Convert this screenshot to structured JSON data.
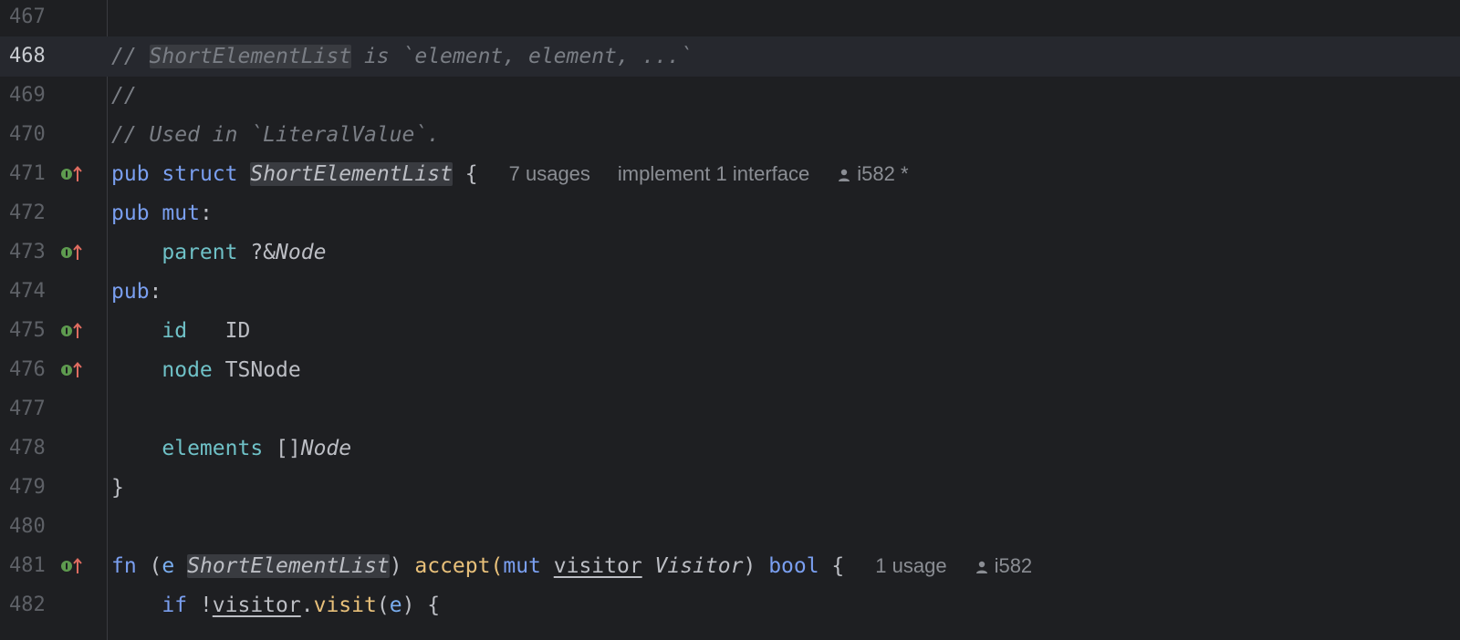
{
  "editor": {
    "colors": {
      "background": "#1e1f22",
      "current_line": "#26282e",
      "keyword": "#7a9ff0",
      "field": "#6fc1c7",
      "function": "#e8c07a",
      "comment": "#7a7e85",
      "gutter_icon_green": "#5e9b4f",
      "gutter_icon_red": "#e06c60"
    },
    "lines": [
      {
        "num": "467"
      },
      {
        "num": "468",
        "t": [
          "// ",
          "ShortElementList",
          " is `element, element, ...`"
        ]
      },
      {
        "num": "469",
        "t": [
          "//"
        ]
      },
      {
        "num": "470",
        "t": [
          "// Used in `LiteralValue`."
        ]
      },
      {
        "num": "471",
        "t": [
          "pub",
          " ",
          "struct",
          " ",
          "ShortElementList",
          " {"
        ],
        "hints": [
          "7 usages",
          "implement 1 interface"
        ],
        "author": "i582 *"
      },
      {
        "num": "472",
        "t": [
          "pub",
          " ",
          "mut",
          ":"
        ]
      },
      {
        "num": "473",
        "t": [
          "    ",
          "parent",
          " ?&",
          "Node"
        ]
      },
      {
        "num": "474",
        "t": [
          "pub",
          ":"
        ]
      },
      {
        "num": "475",
        "t": [
          "    ",
          "id",
          "   ID"
        ]
      },
      {
        "num": "476",
        "t": [
          "    ",
          "node",
          " TSNode"
        ]
      },
      {
        "num": "477"
      },
      {
        "num": "478",
        "t": [
          "    ",
          "elements",
          " []",
          "Node"
        ]
      },
      {
        "num": "479",
        "t": [
          "}"
        ]
      },
      {
        "num": "480"
      },
      {
        "num": "481",
        "t": [
          "fn",
          " (",
          "e",
          " ",
          "ShortElementList",
          ") ",
          "accept",
          "(",
          "mut",
          " ",
          "visitor",
          " ",
          "Visitor",
          ") ",
          "bool",
          " {"
        ],
        "hints": [
          "1 usage"
        ],
        "author": "i582"
      },
      {
        "num": "482",
        "t": [
          "    ",
          "if",
          " !",
          "visitor",
          ".",
          "visit",
          "(",
          "e",
          ") {"
        ]
      }
    ],
    "gutter_icon": "implementation-marker-icon"
  }
}
